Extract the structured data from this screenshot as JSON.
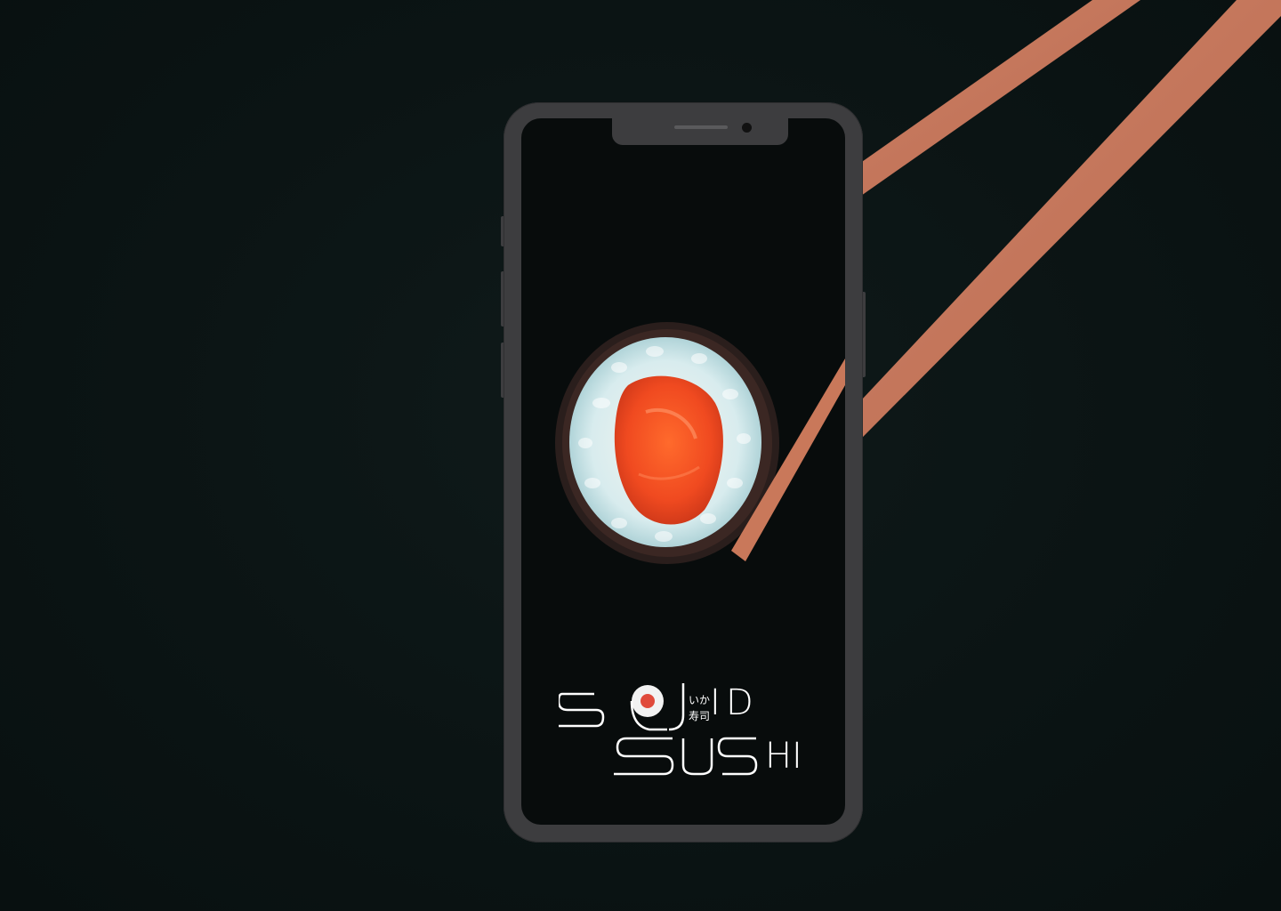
{
  "app": {
    "logo": {
      "row1": [
        "S",
        "I",
        "D"
      ],
      "row2": [
        "S",
        "U",
        "S",
        "H",
        "I"
      ],
      "kana": "いか",
      "kanji": "寿司"
    },
    "colors": {
      "background": "#0b1414",
      "phone_frame": "#3d3d3f",
      "accent_red": "#e04a3b",
      "chopstick": "#c97a5e",
      "salmon": "#ff5a2a",
      "rice": "#cfe4e6"
    },
    "icons": [
      "sushi-roll-illustration",
      "chopsticks-illustration",
      "sushi-logo-icon"
    ]
  }
}
